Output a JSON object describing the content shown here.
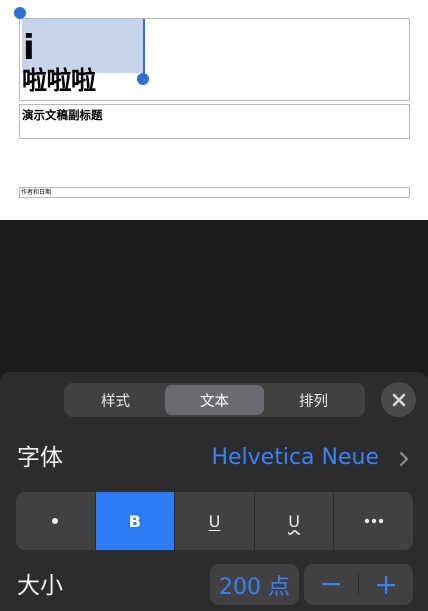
{
  "slide": {
    "cursor_char": "i",
    "title": "啦啦啦",
    "subtitle": "演示文稿副标题",
    "author": "作者和日期"
  },
  "inspector": {
    "tabs": [
      {
        "label": "样式",
        "active": false
      },
      {
        "label": "文本",
        "active": true
      },
      {
        "label": "排列",
        "active": false
      }
    ],
    "font_label": "字体",
    "font_value": "Helvetica Neue",
    "style_buttons": {
      "bold": "B",
      "underline": "U",
      "underline_wavy": "U"
    },
    "size_label": "大小",
    "size_value": "200 点"
  },
  "colors": {
    "accent": "#3b82f6",
    "selection": "#c6d5ea",
    "panel_bg": "#2c2c2e",
    "control_bg": "#414144"
  }
}
